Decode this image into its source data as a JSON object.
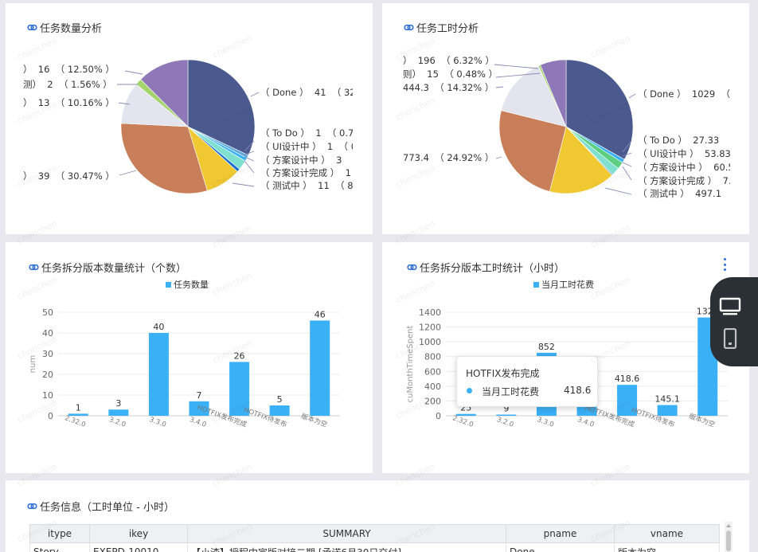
{
  "watermark": "chenchen",
  "colors": {
    "accent": "#3ab0f7",
    "link_icon": "#2f6fd6"
  },
  "pie1": {
    "title": "任务数量分析",
    "labels": [
      {
        "text": "）  16  （ 12.50% ）"
      },
      {
        "text": "测）  2  （ 1.56% ）"
      },
      {
        "text": "）  13  （ 10.16% ）"
      },
      {
        "text": "）  39  （ 30.47% ）"
      },
      {
        "text": "（ Done ）  41  （ 32."
      },
      {
        "text": "（ To Do ）  1  （ 0.78"
      },
      {
        "text": "（ UI设计中 ）  1  （ 0"
      },
      {
        "text": "（ 方案设计中 ）  3  （"
      },
      {
        "text": "（ 方案设计完成 ）  1"
      },
      {
        "text": "（ 测试中 ）  11  （ 8."
      }
    ],
    "slices": [
      {
        "value": 41,
        "color": "#4a5a8e"
      },
      {
        "value": 1,
        "color": "#5fa8d8"
      },
      {
        "value": 1,
        "color": "#3ab0f7"
      },
      {
        "value": 3,
        "color": "#7fe0d0"
      },
      {
        "value": 1,
        "color": "#1f6fd1"
      },
      {
        "value": 11,
        "color": "#f0c832"
      },
      {
        "value": 39,
        "color": "#c87e58"
      },
      {
        "value": 13,
        "color": "#e4e4ee"
      },
      {
        "value": 2,
        "color": "#a4d46c"
      },
      {
        "value": 16,
        "color": "#8f78b8"
      }
    ]
  },
  "pie2": {
    "title": "任务工时分析",
    "labels": [
      {
        "text": "）  196  （ 6.32% ）"
      },
      {
        "text": "则）  15  （ 0.48% ）"
      },
      {
        "text": "444.3  （ 14.32% ）"
      },
      {
        "text": "773.4  （ 24.92% ）"
      },
      {
        "text": "（ Done ）  1029  （ 3"
      },
      {
        "text": "（ To Do ）  27.33  （"
      },
      {
        "text": "（ UI设计中 ）  53.83"
      },
      {
        "text": "（ 方案设计中 ）  60.5"
      },
      {
        "text": "（ 方案设计完成 ）  7."
      },
      {
        "text": "（ 测试中 ）  497.1  （"
      }
    ],
    "slices": [
      {
        "value": 1029,
        "color": "#4a5a8e"
      },
      {
        "value": 27.33,
        "color": "#3ab0f7"
      },
      {
        "value": 53.83,
        "color": "#5ccf82"
      },
      {
        "value": 60.5,
        "color": "#7fe0d0"
      },
      {
        "value": 7,
        "color": "#1f6fd1"
      },
      {
        "value": 497.1,
        "color": "#f0c832"
      },
      {
        "value": 773.4,
        "color": "#c87e58"
      },
      {
        "value": 444.3,
        "color": "#e4e4ee"
      },
      {
        "value": 15,
        "color": "#a4d46c"
      },
      {
        "value": 196,
        "color": "#8f78b8"
      }
    ]
  },
  "bar1": {
    "title": "任务拆分版本数量统计（个数）",
    "legend": "任务数量",
    "chart_data": {
      "type": "bar",
      "categories": [
        "2.32.0",
        "3.2.0",
        "3.3.0",
        "3.4.0",
        "HOTFIX发布完成",
        "HOTFIX待发布",
        "版本为空"
      ],
      "series": [
        {
          "name": "任务数量",
          "values": [
            1,
            3,
            40,
            7,
            26,
            5,
            46
          ]
        }
      ],
      "ylabel": "num",
      "ylim": [
        0,
        50
      ],
      "yticks": [
        "0",
        "10",
        "20",
        "30",
        "40",
        "50"
      ],
      "data_labels": [
        "1",
        "3",
        "40",
        "7",
        "26",
        "5",
        "46"
      ]
    }
  },
  "bar2": {
    "title": "任务拆分版本工时统计（小时）",
    "legend": "当月工时花费",
    "chart_data": {
      "type": "bar",
      "categories": [
        "2.32.0",
        "3.2.0",
        "3.3.0",
        "3.4.0",
        "HOTFIX发布完成",
        "HOTFIX待发布",
        "版本为空"
      ],
      "series": [
        {
          "name": "当月工时花费",
          "values": [
            25,
            9,
            852,
            206,
            418.6,
            145.1,
            1329
          ]
        }
      ],
      "ylabel": "cuMonthTimeSpent",
      "ylim": [
        0,
        1400
      ],
      "yticks": [
        "0",
        "200",
        "400",
        "600",
        "800",
        "1000",
        "1200",
        "1400"
      ],
      "data_labels": [
        "25",
        "9",
        "852",
        "",
        "418.6",
        "145.1",
        "1329"
      ]
    },
    "tooltip": {
      "title": "HOTFIX发布完成",
      "series_name": "当月工时花费",
      "value": "418.6"
    }
  },
  "table": {
    "title": "任务信息（工时单位 - 小时）",
    "columns": [
      "itype",
      "ikey",
      "SUMMARY",
      "pname",
      "vname"
    ],
    "rows": [
      [
        "Story",
        "EXEPD-10010",
        "【小渣】授程中宣版对接二期 [承诺6月30日交付]",
        "Done",
        "版本为空"
      ]
    ]
  }
}
